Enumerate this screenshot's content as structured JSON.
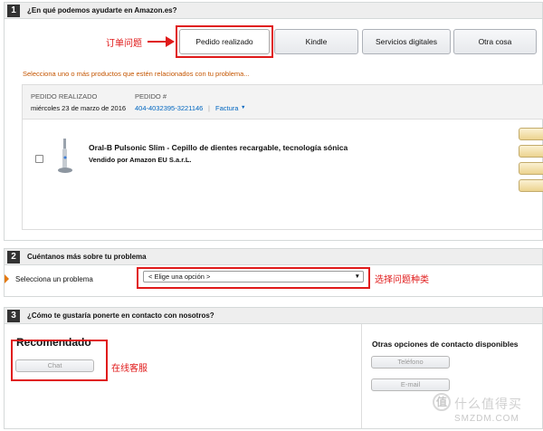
{
  "section1": {
    "number": "1",
    "title": "¿En qué podemos ayudarte en Amazon.es?",
    "tabs": [
      {
        "label": "Pedido realizado",
        "active": true
      },
      {
        "label": "Kindle",
        "active": false
      },
      {
        "label": "Servicios digitales",
        "active": false
      },
      {
        "label": "Otra cosa",
        "active": false
      }
    ],
    "annotation": "订单问题",
    "prompt": "Selecciona uno o más productos que estén relacionados con tu problema...",
    "order": {
      "placed_label": "PEDIDO REALIZADO",
      "placed_date": "miércoles 23 de marzo de 2016",
      "number_label": "PEDIDO #",
      "number_value": "404-4032395-3221146",
      "separator": "|",
      "invoice_label": "Factura",
      "invoice_caret": "▼",
      "product_title": "Oral-B Pulsonic Slim - Cepillo de dientes recargable, tecnología sónica",
      "product_seller": "Vendido por Amazon EU S.a.r.L."
    }
  },
  "section2": {
    "number": "2",
    "title": "Cuéntanos más sobre tu problema",
    "select_label": "Selecciona un problema",
    "select_value": "< Elige una opción >",
    "select_caret": "▼",
    "annotation": "选择问题种类"
  },
  "section3": {
    "number": "3",
    "title": "¿Cómo te gustaría ponerte en contacto con nosotros?",
    "recommended": "Recomendado",
    "chat_label": "Chat",
    "annotation": "在线客服",
    "other_title": "Otras opciones de contacto disponibles",
    "phone_label": "Teléfono",
    "email_label": "E-mail"
  },
  "watermark": {
    "symbol": "值",
    "cn": "什么值得买",
    "en": "SMZDM.COM"
  },
  "colors": {
    "annotation_red": "#e01a1a",
    "prompt_orange": "#c45500",
    "link_blue": "#0066c0"
  }
}
